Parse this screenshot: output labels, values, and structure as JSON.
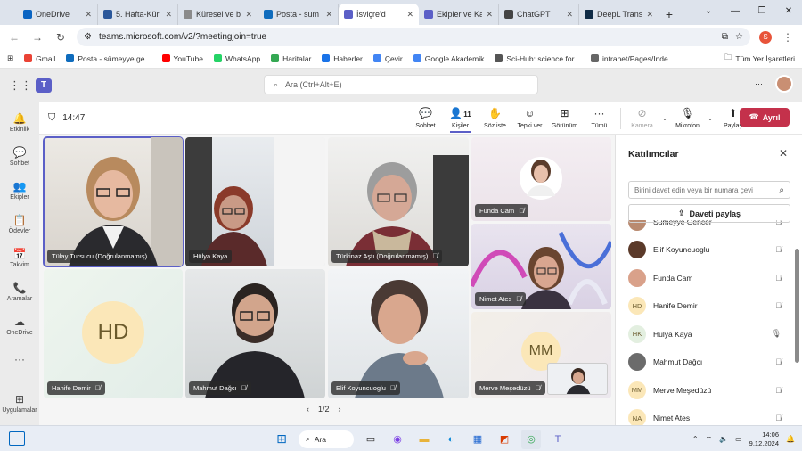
{
  "browser": {
    "tabs": [
      {
        "label": "OneDrive",
        "color": "#0a64c2",
        "active": false
      },
      {
        "label": "5. Hafta-Kür",
        "color": "#2b579a",
        "active": false
      },
      {
        "label": "Küresel ve b",
        "color": "#8b8b8b",
        "active": false
      },
      {
        "label": "Posta - sum",
        "color": "#0f6cbd",
        "active": false
      },
      {
        "label": "İsviçre'd",
        "color": "#5b5fc7",
        "active": true
      },
      {
        "label": "Ekipler ve Ka",
        "color": "#5b5fc7",
        "active": false
      },
      {
        "label": "ChatGPT",
        "color": "#444444",
        "active": false
      },
      {
        "label": "DeepL Transl",
        "color": "#0f2b46",
        "active": false
      }
    ],
    "new_tab": "+",
    "url": "teams.microsoft.com/v2/?meetingjoin=true",
    "profile_initial": "S",
    "bookmarks": [
      "Gmail",
      "Posta - sümeyye ge...",
      "YouTube",
      "WhatsApp",
      "Haritalar",
      "Haberler",
      "Çevir",
      "Google Akademik",
      "Sci-Hub: science for...",
      "intranet/Pages/Inde..."
    ],
    "bookmarks_all": "Tüm Yer İşaretleri"
  },
  "teams": {
    "search_placeholder": "Ara (Ctrl+Alt+E)",
    "more": "···",
    "rail": [
      {
        "label": "Etkinlik",
        "icon": "bell-icon",
        "glyph": "🔔"
      },
      {
        "label": "Sohbet",
        "icon": "chat-icon",
        "glyph": "💬"
      },
      {
        "label": "Ekipler",
        "icon": "teams-icon",
        "glyph": "👥"
      },
      {
        "label": "Ödevler",
        "icon": "assignments-icon",
        "glyph": "📋"
      },
      {
        "label": "Takvim",
        "icon": "calendar-icon",
        "glyph": "📅"
      },
      {
        "label": "Aramalar",
        "icon": "phone-icon",
        "glyph": "📞"
      },
      {
        "label": "OneDrive",
        "icon": "cloud-icon",
        "glyph": "☁"
      }
    ],
    "rail_more": "···",
    "rail_apps": "Uygulamalar"
  },
  "meeting": {
    "time": "14:47",
    "tools": {
      "chat": "Sohbet",
      "people": "Kişiler",
      "people_count": "11",
      "raise": "Söz iste",
      "react": "Tepki ver",
      "view": "Görünüm",
      "more": "Tümü",
      "camera": "Kamera",
      "mic": "Mikrofon",
      "share": "Paylaş"
    },
    "leave": "Ayrıl",
    "pager": "1/2",
    "tiles": [
      {
        "name": "Tülay Tursucu (Doğrulanmamış)"
      },
      {
        "name": "Hülya Kaya"
      },
      {
        "name": "Türkinaz Aştı (Doğrulanmamış)"
      },
      {
        "name": "Funda Cam"
      },
      {
        "name": "Nimet Ates"
      },
      {
        "name": "Hanife Demir",
        "initials": "HD"
      },
      {
        "name": "Mahmut Dağcı"
      },
      {
        "name": "Elif Koyuncuoglu"
      },
      {
        "name": "Merve Meşedüzü",
        "initials": "MM"
      }
    ]
  },
  "panel": {
    "title": "Katılımcılar",
    "invite_placeholder": "Birini davet edin veya bir numara çevi",
    "share_invite": "Daveti paylaş",
    "participants": [
      {
        "name": "Sümeyye Gencer",
        "initials": "",
        "bg": "#b98a70",
        "mic": "muted"
      },
      {
        "name": "Elif Koyuncuoglu",
        "initials": "",
        "bg": "#5b3a2a",
        "mic": "muted"
      },
      {
        "name": "Funda Cam",
        "initials": "",
        "bg": "#d9a18a",
        "mic": "muted"
      },
      {
        "name": "Hanife Demir",
        "initials": "HD",
        "bg": "#fbe7b8",
        "mic": "muted"
      },
      {
        "name": "Hülya Kaya",
        "initials": "HK",
        "bg": "#e3efe0",
        "mic": "on"
      },
      {
        "name": "Mahmut Dağcı",
        "initials": "",
        "bg": "#6b6b6b",
        "mic": "muted"
      },
      {
        "name": "Merve Meşedüzü",
        "initials": "MM",
        "bg": "#fbe7b8",
        "mic": "muted"
      },
      {
        "name": "Nimet Ates",
        "initials": "NA",
        "bg": "#fbe7b8",
        "mic": "muted"
      }
    ]
  },
  "taskbar": {
    "search": "Ara",
    "time": "14:06",
    "date": "9.12.2024"
  }
}
